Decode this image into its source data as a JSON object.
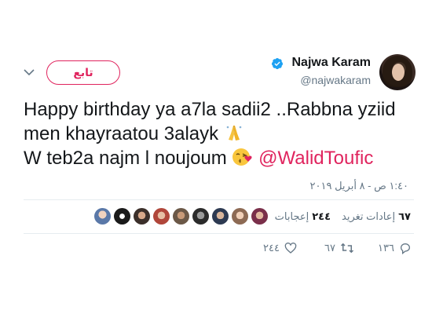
{
  "user": {
    "name": "Najwa Karam",
    "handle": "@najwakaram"
  },
  "follow_button": {
    "label": "تابع"
  },
  "tweet": {
    "line1": "Happy birthday ya a7la sadii2 ..Rabbna yziid",
    "line2": "men khayraatou 3alayk",
    "line3": "W teb2a najm l noujoum",
    "mention": "@WalidToufic",
    "timestamp": "١:٤٠ ص - ٨ أبريل ٢٠١٩"
  },
  "stats": {
    "retweets_count": "٦٧",
    "retweets_label": "إعادات تغريد",
    "likes_count": "٢٤٤",
    "likes_label": "إعجابات"
  },
  "actions": {
    "replies": "١٣٦",
    "retweets": "٦٧",
    "likes": "٢٤٤"
  },
  "icons": {
    "verified": "verified-badge-icon",
    "caret": "chevron-down-icon",
    "reply": "reply-icon",
    "retweet": "retweet-icon",
    "like": "heart-icon",
    "emoji1": "folded-hands-emoji",
    "emoji2": "face-blowing-kiss-emoji"
  },
  "colors": {
    "accent": "#e0245e",
    "verified": "#1da1f2",
    "muted": "#657786",
    "text": "#14171a"
  }
}
